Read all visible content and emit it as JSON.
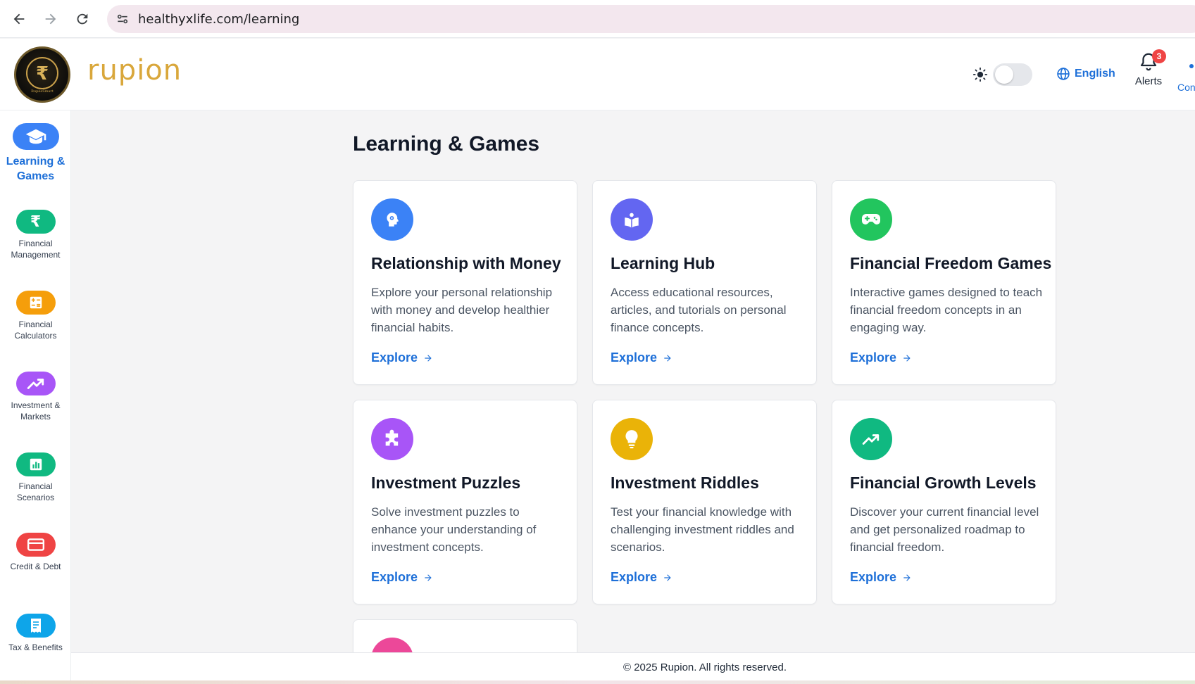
{
  "browser": {
    "url": "healthyxlife.com/learning"
  },
  "header": {
    "brand": "rupion",
    "logo_symbol": "₹",
    "logo_caption": "RupeeSmart",
    "language": "English",
    "alerts_label": "Alerts",
    "alerts_count": "3",
    "contact_fragment": "Con"
  },
  "sidebar": {
    "items": [
      {
        "label": "Learning & Games",
        "icon": "graduation-cap-icon",
        "color": "#3b82f6"
      },
      {
        "label": "Financial Management",
        "icon": "rupee-icon",
        "color": "#10b981"
      },
      {
        "label": "Financial Calculators",
        "icon": "calculator-icon",
        "color": "#f59e0b"
      },
      {
        "label": "Investment & Markets",
        "icon": "trending-up-icon",
        "color": "#a855f7"
      },
      {
        "label": "Financial Scenarios",
        "icon": "bar-chart-icon",
        "color": "#10b981"
      },
      {
        "label": "Credit & Debt",
        "icon": "credit-card-icon",
        "color": "#ef4444"
      },
      {
        "label": "Tax & Benefits",
        "icon": "receipt-icon",
        "color": "#0ea5e9"
      }
    ]
  },
  "main": {
    "title": "Learning & Games",
    "explore_label": "Explore",
    "cards": [
      {
        "title": "Relationship with Money",
        "description": "Explore your personal relationship with money and develop healthier financial habits.",
        "icon": "brain-icon",
        "color": "#3b82f6"
      },
      {
        "title": "Learning Hub",
        "description": "Access educational resources, articles, and tutorials on personal finance concepts.",
        "icon": "book-icon",
        "color": "#6366f1"
      },
      {
        "title": "Financial Freedom Games",
        "description": "Interactive games designed to teach financial freedom concepts in an engaging way.",
        "icon": "gamepad-icon",
        "color": "#22c55e"
      },
      {
        "title": "Investment Puzzles",
        "description": "Solve investment puzzles to enhance your understanding of investment concepts.",
        "icon": "puzzle-icon",
        "color": "#a855f7"
      },
      {
        "title": "Investment Riddles",
        "description": "Test your financial knowledge with challenging investment riddles and scenarios.",
        "icon": "lightbulb-icon",
        "color": "#eab308"
      },
      {
        "title": "Financial Growth Levels",
        "description": "Discover your current financial level and get personalized roadmap to financial freedom.",
        "icon": "trending-up-icon",
        "color": "#10b981"
      },
      {
        "title": "",
        "description": "",
        "icon": "partial-icon",
        "color": "#ec4899"
      }
    ]
  },
  "footer": {
    "text": "© 2025 Rupion. All rights reserved."
  }
}
